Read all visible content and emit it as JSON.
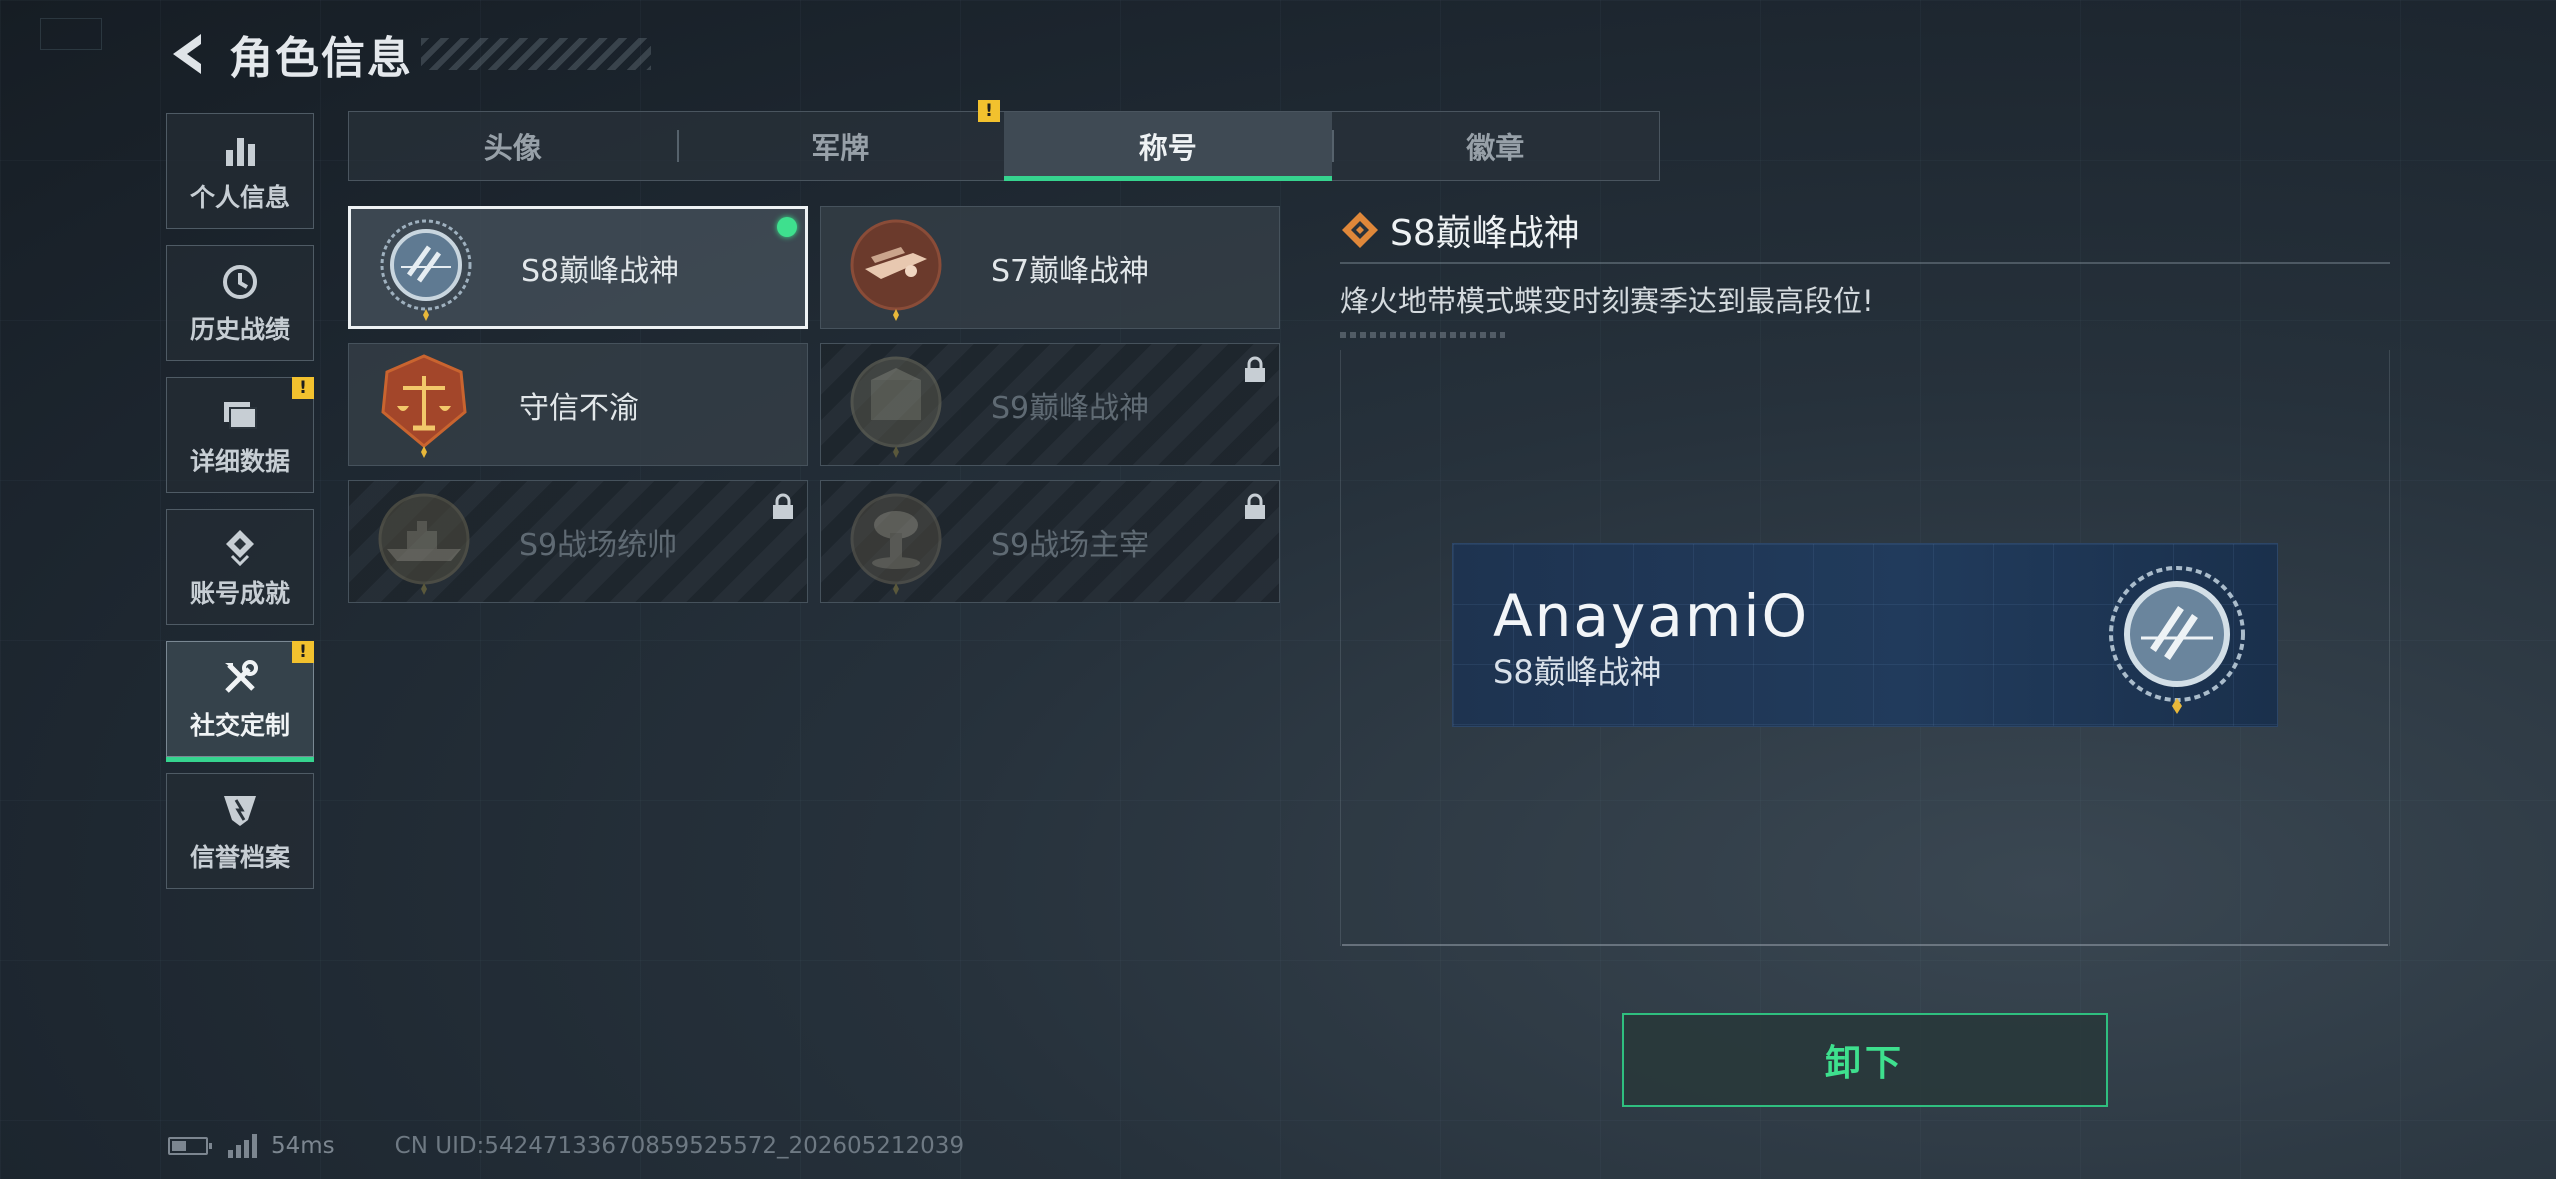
{
  "header": {
    "title": "角色信息"
  },
  "sidebar": {
    "items": [
      {
        "label": "个人信息",
        "icon": "bar-chart-icon",
        "active": false,
        "warn": false
      },
      {
        "label": "历史战绩",
        "icon": "history-clock-icon",
        "active": false,
        "warn": false
      },
      {
        "label": "详细数据",
        "icon": "folder-icon",
        "active": false,
        "warn": true
      },
      {
        "label": "账号成就",
        "icon": "achievement-icon",
        "active": false,
        "warn": false
      },
      {
        "label": "社交定制",
        "icon": "tools-icon",
        "active": true,
        "warn": true
      },
      {
        "label": "信誉档案",
        "icon": "credit-shield-icon",
        "active": false,
        "warn": false
      }
    ],
    "warn_symbol": "!"
  },
  "tabs": [
    {
      "label": "头像",
      "active": false
    },
    {
      "label": "军牌",
      "active": false,
      "warn": true
    },
    {
      "label": "称号",
      "active": true
    },
    {
      "label": "徽章",
      "active": false
    }
  ],
  "titles": [
    {
      "name": "S8巅峰战神",
      "emblem": "s8-crest-icon",
      "selected": true,
      "equipped": true,
      "locked": false
    },
    {
      "name": "S7巅峰战神",
      "emblem": "s7-crest-icon",
      "selected": false,
      "equipped": false,
      "locked": false
    },
    {
      "name": "守信不渝",
      "emblem": "scales-crest-icon",
      "selected": false,
      "equipped": false,
      "locked": false
    },
    {
      "name": "S9巅峰战神",
      "emblem": "s9-crest-icon",
      "selected": false,
      "equipped": false,
      "locked": true
    },
    {
      "name": "S9战场统帅",
      "emblem": "warship-crest-icon",
      "selected": false,
      "equipped": false,
      "locked": true
    },
    {
      "name": "S9战场主宰",
      "emblem": "mushroom-cloud-crest-icon",
      "selected": false,
      "equipped": false,
      "locked": true
    }
  ],
  "detail": {
    "title": "S8巅峰战神",
    "description": "烽火地带模式蝶变时刻赛季达到最高段位!"
  },
  "nameplate": {
    "player_name": "AnayamiO",
    "title": "S8巅峰战神"
  },
  "action": {
    "unequip_label": "卸下"
  },
  "status": {
    "ping": "54ms",
    "uid": "CN UID:54247133670859525572_202605212039"
  },
  "colors": {
    "accent_green": "#36d48f",
    "warn_yellow": "#f2c12e",
    "plate_blue": "#213b5c"
  }
}
